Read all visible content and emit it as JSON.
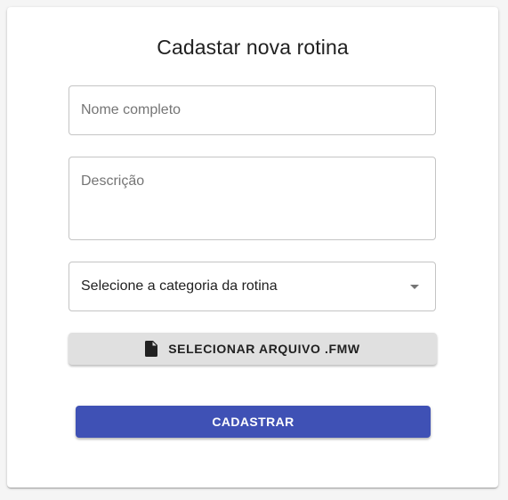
{
  "form": {
    "title": "Cadastar nova rotina",
    "name_field": {
      "placeholder": "Nome completo",
      "value": ""
    },
    "description_field": {
      "placeholder": "Descrição",
      "value": ""
    },
    "category_select": {
      "selected": "Selecione a categoria da rotina"
    },
    "file_button": {
      "label": "SELECIONAR ARQUIVO .FMW",
      "icon": "file-icon"
    },
    "submit_button": {
      "label": "CADASTRAR"
    }
  },
  "colors": {
    "primary": "#3f51b5",
    "file_button_bg": "#e0e0e0",
    "border": "#c4c4c4",
    "placeholder": "#757575"
  }
}
